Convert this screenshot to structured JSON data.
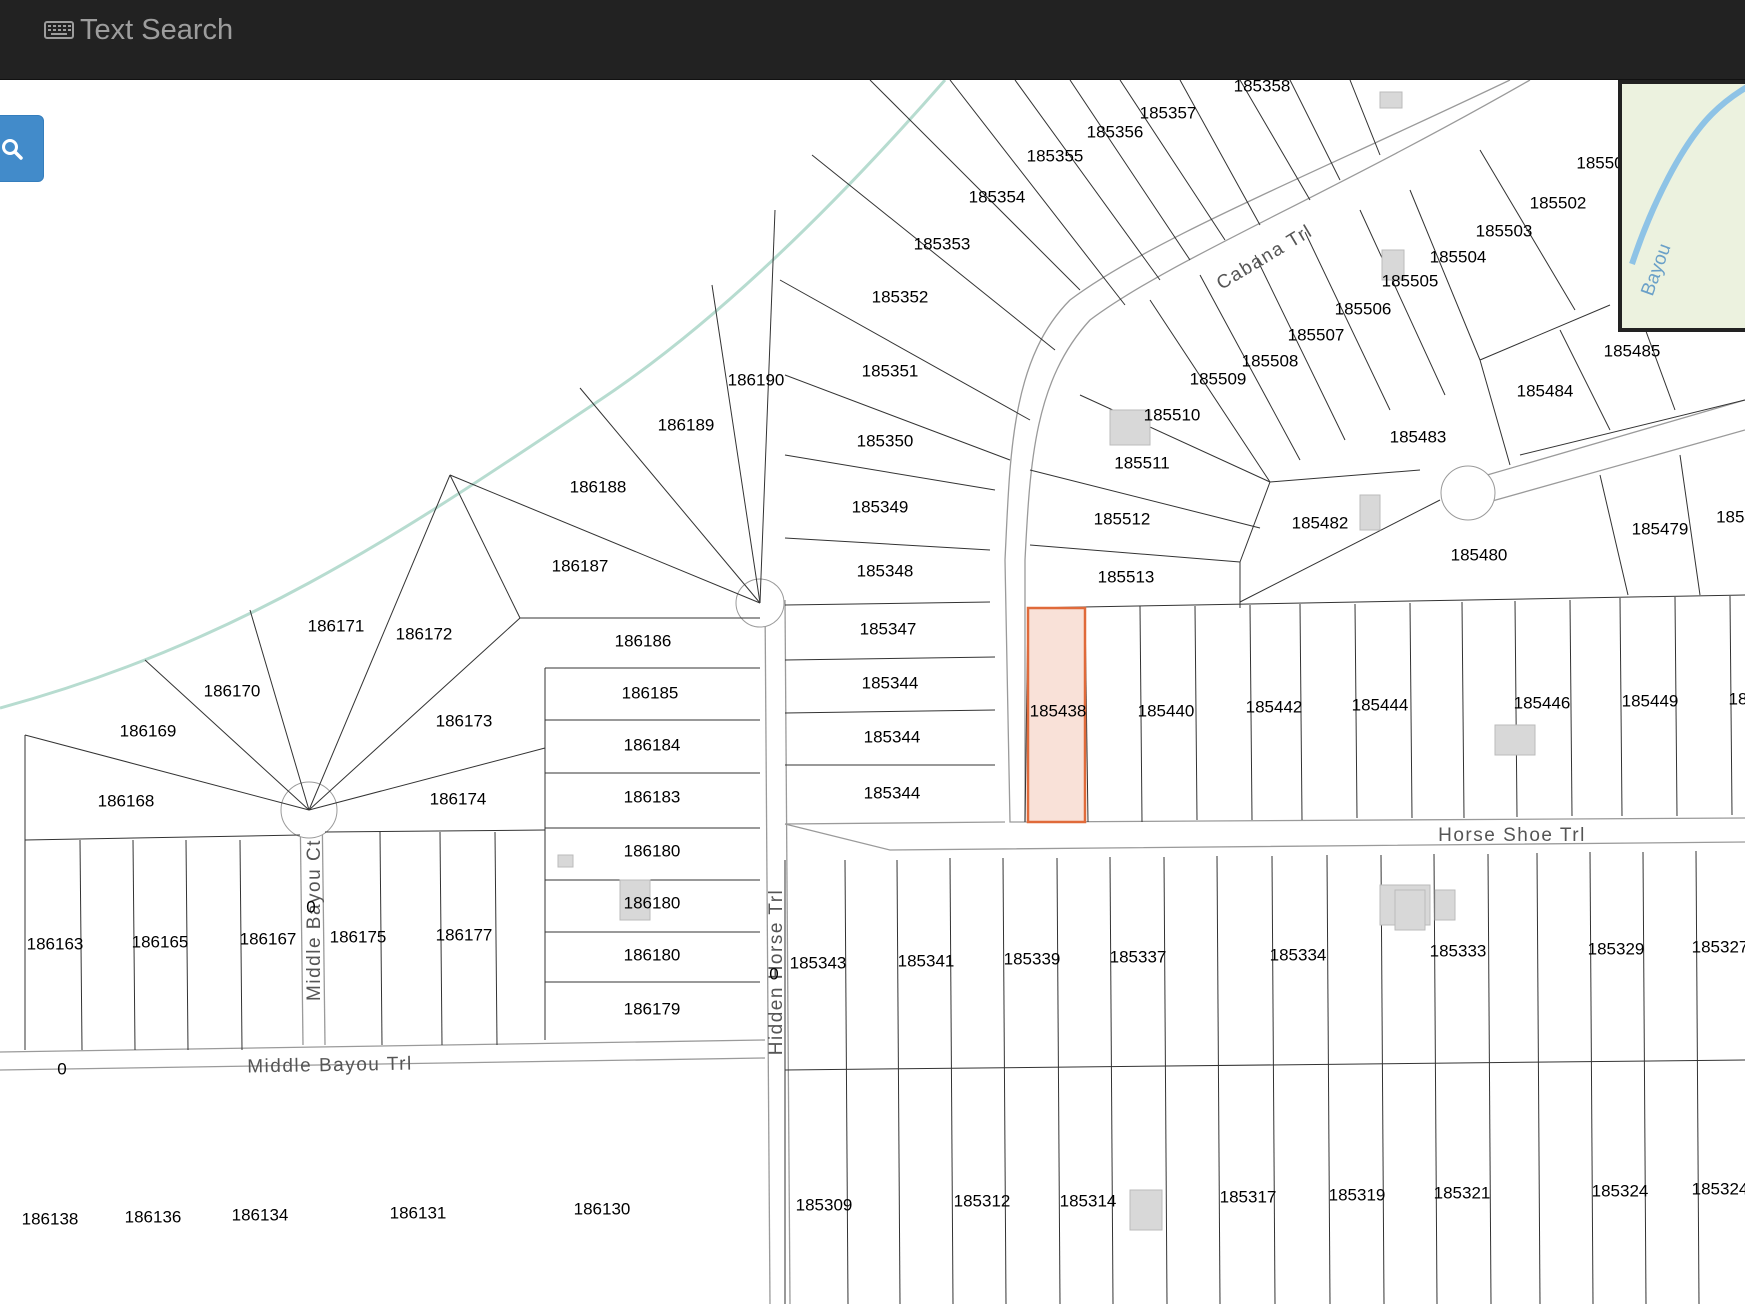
{
  "navbar": {
    "title": "Text Search",
    "icon": "keyboard-icon"
  },
  "search_button": {
    "icon": "search-icon"
  },
  "map": {
    "highlight_color": "#e06a3a",
    "roads": [
      {
        "id": "cabana",
        "name": "Cabana Trl"
      },
      {
        "id": "horseshoe",
        "name": "Horse Shoe Trl"
      },
      {
        "id": "hidden",
        "name": "Hidden Horse Trl"
      },
      {
        "id": "middlect",
        "name": "Middle Bayou Ct"
      },
      {
        "id": "middletrl",
        "name": "Middle Bayou Trl"
      }
    ],
    "zero_labels": [
      "0",
      "0",
      "0"
    ],
    "parcels": [
      "185358",
      "185357",
      "185356",
      "185355",
      "185354",
      "185353",
      "185352",
      "185351",
      "185350",
      "185349",
      "185348",
      "185347",
      "185344",
      "185344",
      "185344",
      "186190",
      "186189",
      "186188",
      "186187",
      "186186",
      "186185",
      "186184",
      "186183",
      "186180",
      "186180",
      "186180",
      "186179",
      "186171",
      "186172",
      "186170",
      "186169",
      "186168",
      "186173",
      "186174",
      "186163",
      "186165",
      "186167",
      "186175",
      "186177",
      "185343",
      "185341",
      "185339",
      "185337",
      "185334",
      "185333",
      "185329",
      "185327",
      "185438",
      "185440",
      "185442",
      "185444",
      "185446",
      "185449",
      "185509",
      "185508",
      "185507",
      "185506",
      "185505",
      "185504",
      "185503",
      "185502",
      "185510",
      "185511",
      "185512",
      "185513",
      "185482",
      "185480",
      "185479",
      "185485",
      "185484",
      "185483",
      "186138",
      "186136",
      "186134",
      "186131",
      "186130",
      "185309",
      "185312",
      "185314",
      "185317",
      "185319",
      "185321",
      "185324",
      "185324",
      "18550",
      "1854",
      "18"
    ],
    "inset": {
      "label": "Bayou"
    }
  }
}
